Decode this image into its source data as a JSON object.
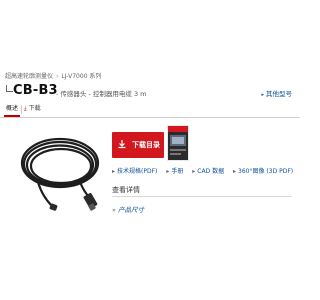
{
  "breadcrumb": {
    "items": [
      "超高速轮廓测量仪",
      "LJ-V7000 系列"
    ]
  },
  "product": {
    "code": "CB-B3",
    "description": "- 传感器头 - 控制器用电缆 3 m",
    "other_models": "其他型号"
  },
  "tabs": [
    {
      "label": "概述"
    },
    {
      "label": "下载"
    }
  ],
  "download": {
    "button_label": "下载目录"
  },
  "resources": [
    {
      "label": "技术规格(PDF)",
      "icon": "document-icon"
    },
    {
      "label": "手册",
      "icon": "book-icon"
    },
    {
      "label": "CAD 数据",
      "icon": "cad-icon"
    },
    {
      "label": "360°图像 (3D PDF)",
      "icon": "cube-icon"
    }
  ],
  "details": {
    "title": "查看详情",
    "product_size": "产品尺寸"
  },
  "colors": {
    "accent": "#d2171f",
    "link": "#0b4f9b"
  }
}
